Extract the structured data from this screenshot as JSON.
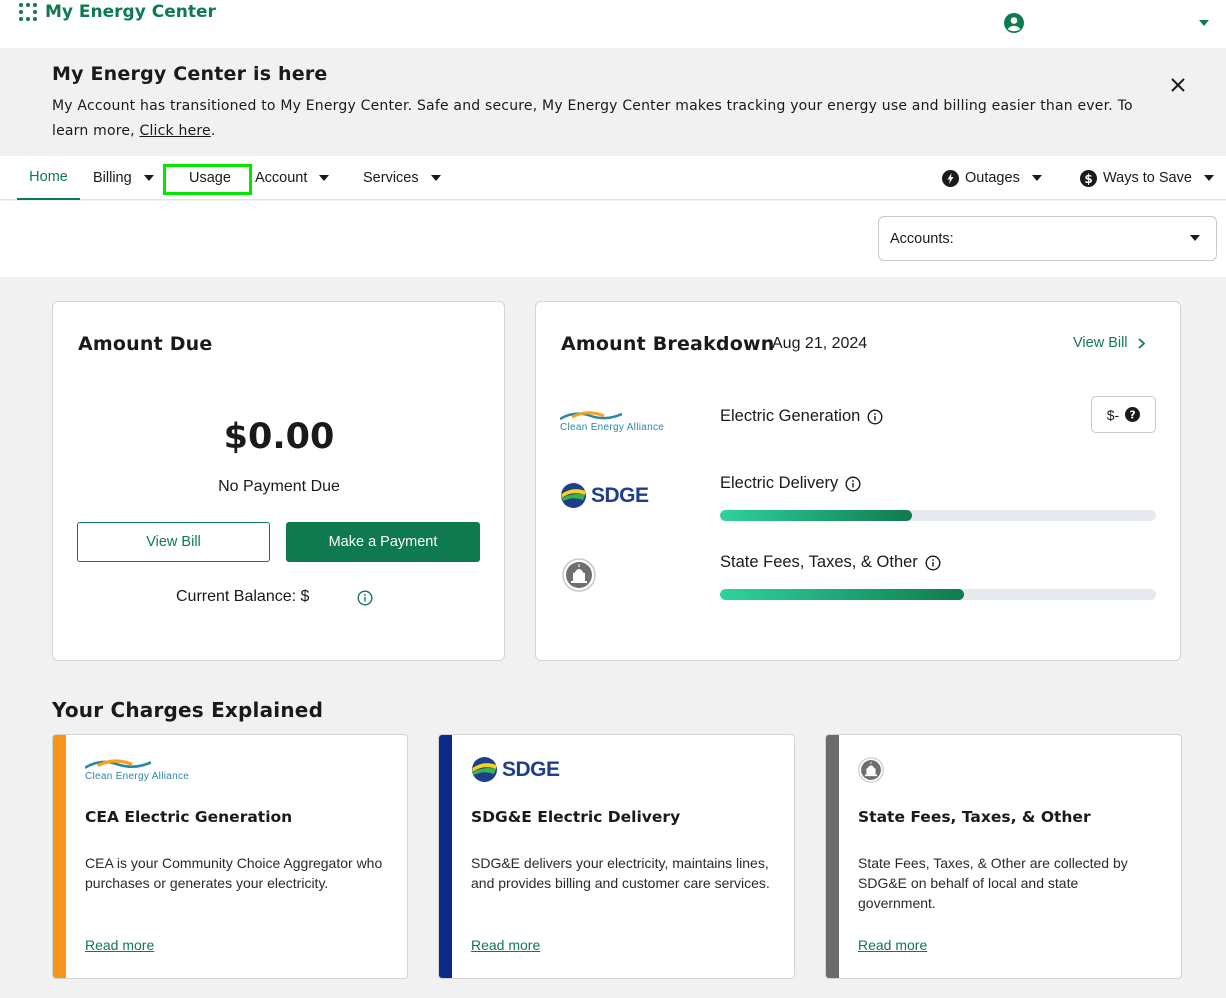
{
  "header": {
    "brand": "My Energy Center"
  },
  "banner": {
    "title": "My Energy Center is here",
    "text_before_link": "My Account has transitioned to My Energy Center. Safe and secure, My Energy Center makes tracking your energy use and billing easier than ever. To learn more, ",
    "link": "Click here",
    "text_after_link": "."
  },
  "nav": {
    "items": [
      {
        "label": "Home"
      },
      {
        "label": "Billing"
      },
      {
        "label": "Usage"
      },
      {
        "label": "Account"
      },
      {
        "label": "Services"
      }
    ],
    "right_items": [
      {
        "label": "Outages"
      },
      {
        "label": "Ways to Save"
      }
    ]
  },
  "accounts": {
    "label": "Accounts:"
  },
  "amount_due": {
    "title": "Amount Due",
    "value": "$0.00",
    "status": "No Payment Due",
    "view_bill": "View Bill",
    "make_payment": "Make a Payment",
    "balance_label": "Current Balance: $"
  },
  "breakdown": {
    "title": "Amount Breakdown",
    "date": "Aug 21, 2024",
    "view_bill": "View Bill",
    "logos": {
      "cea": "Clean Energy Alliance",
      "sdge": "SDGE"
    },
    "rows": [
      {
        "label": "Electric Generation",
        "pill": "$-"
      },
      {
        "label": "Electric Delivery",
        "fill_percent": 44
      },
      {
        "label": "State Fees, Taxes, & Other",
        "fill_percent": 56
      }
    ]
  },
  "charges": {
    "title": "Your Charges Explained",
    "cards": [
      {
        "logo": "Clean Energy Alliance",
        "title": "CEA Electric Generation",
        "desc": "CEA is your Community Choice Aggregator who purchases or generates your electricity.",
        "link": "Read more",
        "stripe_color": "#f7941d"
      },
      {
        "logo": "SDGE",
        "title": "SDG&E Electric Delivery",
        "desc": "SDG&E delivers your electricity, maintains lines, and provides billing and customer care services.",
        "link": "Read more",
        "stripe_color": "#0b2a8a"
      },
      {
        "title": "State Fees, Taxes, & Other",
        "desc": "State Fees, Taxes, & Other are collected by SDG&E on behalf of local and state government.",
        "link": "Read more",
        "stripe_color": "#6b6b6b"
      }
    ]
  },
  "colors": {
    "brand_green": "#0f7a4f",
    "highlight": "#00e600"
  }
}
